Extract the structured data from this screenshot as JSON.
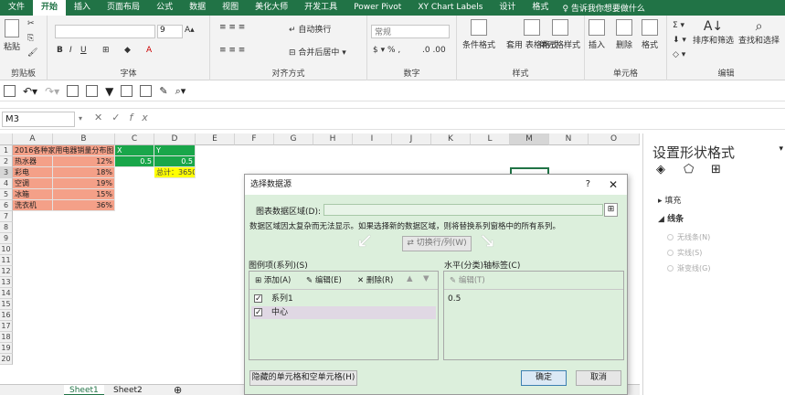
{
  "ribbon_tabs": [
    "文件",
    "开始",
    "插入",
    "页面布局",
    "公式",
    "数据",
    "视图",
    "美化大师",
    "开发工具",
    "Power Pivot",
    "XY Chart Labels",
    "设计",
    "格式"
  ],
  "active_tab": "开始",
  "tell_me": "告诉我你想要做什么",
  "ribbon_groups": {
    "clipboard": "剪贴板",
    "font": "字体",
    "alignment": "对齐方式",
    "number": "数字",
    "styles": "样式",
    "cells": "单元格",
    "editing": "编辑"
  },
  "ribbon_buttons": {
    "paste": "粘贴",
    "wrap_text": "自动换行",
    "merge_center": "合并后居中",
    "number_format": "常规",
    "conditional_format": "条件格式",
    "table_format": "套用\n表格格式",
    "cell_styles": "单元格样式",
    "insert": "插入",
    "delete": "删除",
    "format": "格式",
    "sort_filter": "排序和筛选",
    "find_select": "查找和选择",
    "font_size": "9"
  },
  "namebox": "M3",
  "fx_symbol": "fx",
  "columns": [
    "A",
    "B",
    "C",
    "D",
    "E",
    "F",
    "G",
    "H",
    "I",
    "J",
    "K",
    "L",
    "M",
    "N",
    "O"
  ],
  "rows": [
    "1",
    "2",
    "3",
    "4",
    "5",
    "6",
    "7",
    "8",
    "9",
    "10",
    "11",
    "12",
    "13",
    "14",
    "15",
    "16",
    "17",
    "18",
    "19",
    "20"
  ],
  "cells": {
    "A1": "2016各种家用电器销量分布图",
    "C1": "X",
    "D1": "Y",
    "A2": "热水器",
    "B2": "12%",
    "C2": "0.5",
    "D2": "0.5",
    "A3": "彩电",
    "B3": "18%",
    "D3": "总计：3650",
    "A4": "空调",
    "B4": "19%",
    "A5": "冰箱",
    "B5": "15%",
    "A6": "洗衣机",
    "B6": "36%"
  },
  "sheets": [
    "Sheet1",
    "Sheet2"
  ],
  "active_sheet": "Sheet1",
  "pane": {
    "title": "设置形状格式",
    "fill": "填充",
    "line": "线条",
    "no_line": "无线条(N)",
    "solid_line": "实线(S)",
    "gradient_line": "渐变线(G)"
  },
  "dialog": {
    "title": "选择数据源",
    "help": "?",
    "close": "✕",
    "range_label": "图表数据区域(D):",
    "notice": "数据区域因太复杂而无法显示。如果选择新的数据区域，则将替换系列窗格中的所有系列。",
    "switch_btn": "切换行/列(W)",
    "legend_label": "图例项(系列)(S)",
    "axis_label": "水平(分类)轴标签(C)",
    "add": "添加(A)",
    "edit": "编辑(E)",
    "remove": "删除(R)",
    "axis_edit": "编辑(T)",
    "series": [
      "系列1",
      "中心"
    ],
    "axis_values": [
      "0.5"
    ],
    "hidden_cells_btn": "隐藏的单元格和空单元格(H)",
    "ok": "确定",
    "cancel": "取消"
  }
}
